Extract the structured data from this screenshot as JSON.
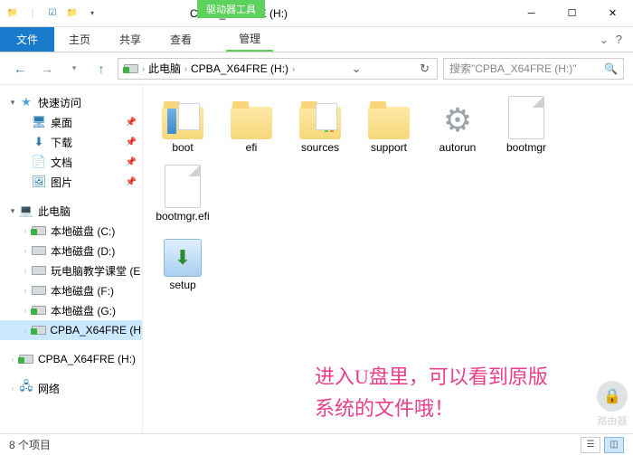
{
  "window": {
    "context_tab": "驱动器工具",
    "title": "CPBA_X64FRE (H:)"
  },
  "ribbon": {
    "file": "文件",
    "home": "主页",
    "share": "共享",
    "view": "查看",
    "manage": "管理"
  },
  "address": {
    "root": "此电脑",
    "current": "CPBA_X64FRE (H:)"
  },
  "search": {
    "placeholder": "搜索\"CPBA_X64FRE (H:)\""
  },
  "nav": {
    "quick_access": "快速访问",
    "desktop": "桌面",
    "downloads": "下载",
    "documents": "文档",
    "pictures": "图片",
    "this_pc": "此电脑",
    "drive_c": "本地磁盘 (C:)",
    "drive_d": "本地磁盘 (D:)",
    "drive_e": "玩电脑教学课堂 (E",
    "drive_f": "本地磁盘 (F:)",
    "drive_g": "本地磁盘 (G:)",
    "drive_h_sel": "CPBA_X64FRE (H:",
    "drive_h2": "CPBA_X64FRE (H:)",
    "network": "网络"
  },
  "files": {
    "boot": "boot",
    "efi": "efi",
    "sources": "sources",
    "support": "support",
    "autorun": "autorun",
    "bootmgr": "bootmgr",
    "bootmgr_efi": "bootmgr.efi",
    "setup": "setup"
  },
  "annotation": {
    "line1": "进入U盘里，可以看到原版",
    "line2": "系统的文件哦！"
  },
  "status": {
    "items": "8 个项目"
  },
  "watermark": {
    "label": "路由器"
  }
}
